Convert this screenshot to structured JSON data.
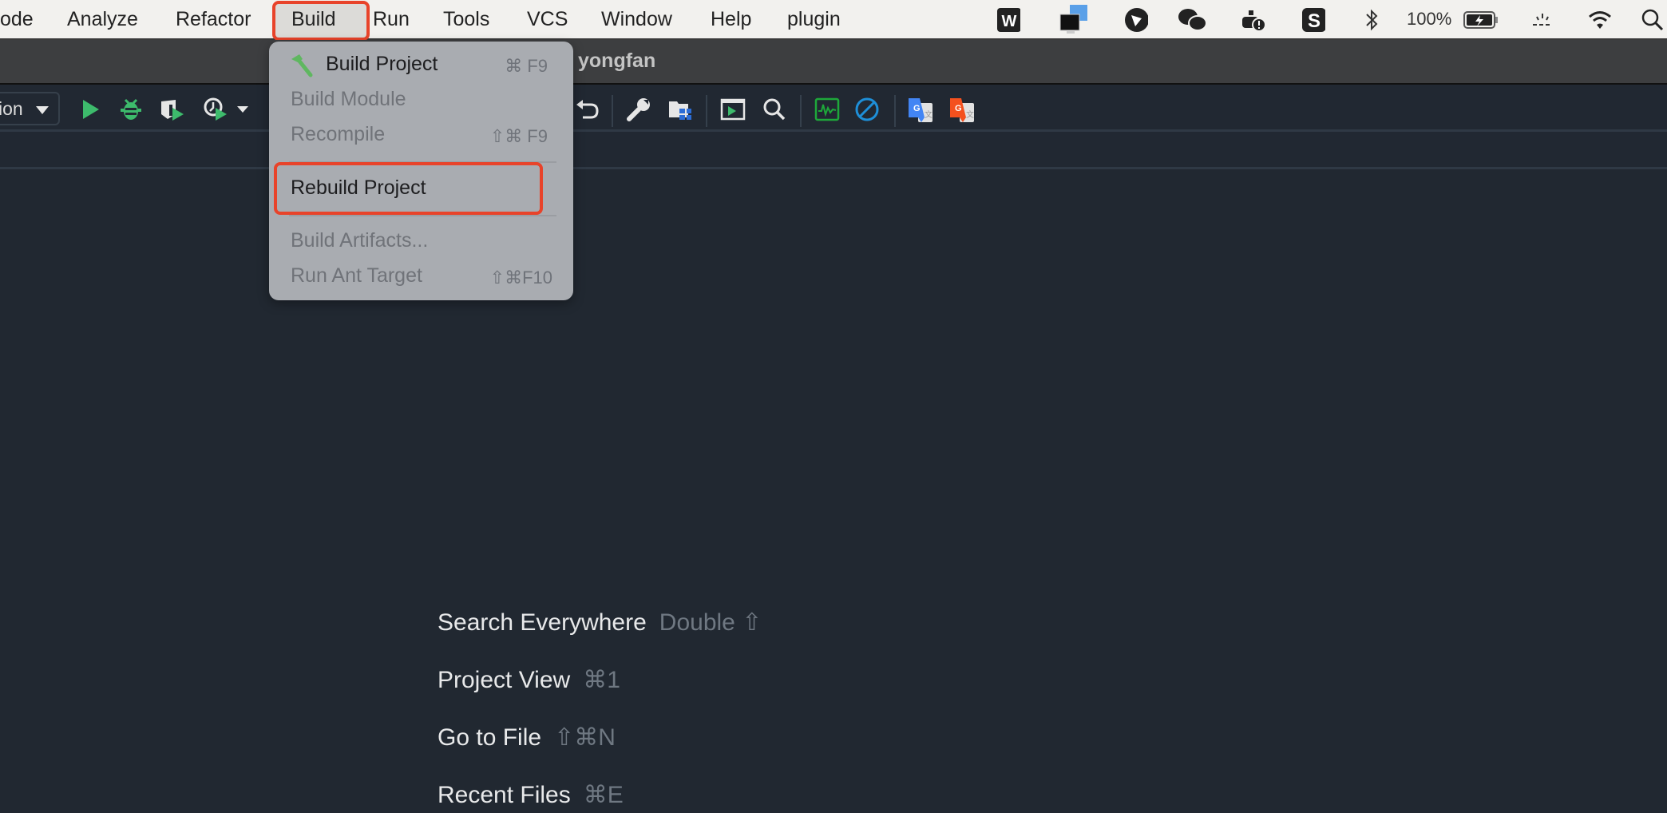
{
  "menubar": {
    "items": [
      "ode",
      "Analyze",
      "Refactor",
      "Build",
      "Run",
      "Tools",
      "VCS",
      "Window",
      "Help",
      "plugin"
    ],
    "active": "Build",
    "tray": {
      "battery_percent": "100%",
      "icons": [
        "wps-icon",
        "screen-sharing-icon",
        "feishu-icon",
        "wechat-icon",
        "docker-icon",
        "sogou-icon",
        "bluetooth-icon",
        "battery-charging-icon",
        "brightness-icon",
        "wifi-icon",
        "spotlight-search-icon"
      ]
    }
  },
  "titlebar": {
    "title": "yongfan"
  },
  "toolbar": {
    "config_label": "ion",
    "icons": [
      "run-icon",
      "debug-icon",
      "coverage-icon",
      "profile-icon",
      "undo-icon",
      "wrench-icon",
      "project-structure-icon",
      "terminal-icon",
      "search-icon",
      "monitor-icon",
      "block-icon",
      "google-translate-icon",
      "google-translate-alt-icon"
    ]
  },
  "build_menu": {
    "items": [
      {
        "label": "Build Project",
        "shortcut": "⌘ F9",
        "enabled": true,
        "icon": "hammer-icon"
      },
      {
        "label": "Build Module",
        "shortcut": "",
        "enabled": false
      },
      {
        "label": "Recompile",
        "shortcut": "⇧⌘ F9",
        "enabled": false
      },
      {
        "label": "Rebuild Project",
        "shortcut": "",
        "enabled": true,
        "highlighted": true
      },
      {
        "label": "Build Artifacts...",
        "shortcut": "",
        "enabled": false
      },
      {
        "label": "Run Ant Target",
        "shortcut": "⇧⌘F10",
        "enabled": false
      }
    ]
  },
  "welcome": {
    "items": [
      {
        "label": "Search Everywhere",
        "shortcut": "Double ⇧"
      },
      {
        "label": "Project View",
        "shortcut": "⌘1"
      },
      {
        "label": "Go to File",
        "shortcut": "⇧⌘N"
      },
      {
        "label": "Recent Files",
        "shortcut": "⌘E"
      }
    ]
  },
  "colors": {
    "highlight_red": "#e8432a",
    "run_green": "#3dbb6c",
    "menubar_bg": "#f2f1ee",
    "editor_bg": "#212831"
  }
}
